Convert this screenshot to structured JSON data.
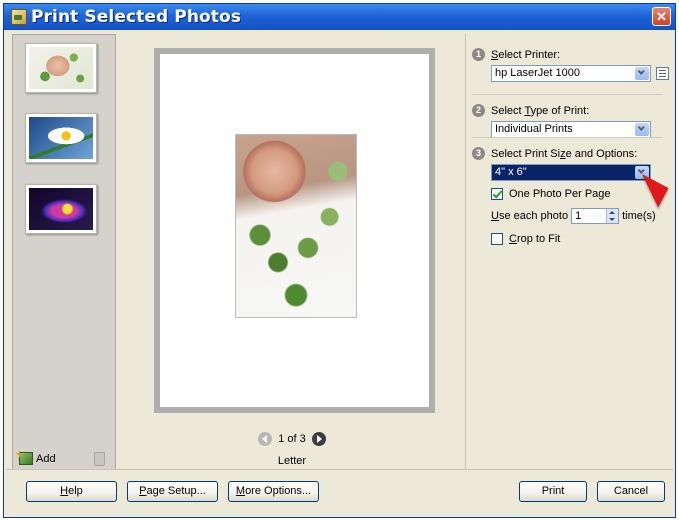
{
  "window": {
    "title": "Print Selected Photos",
    "close_label": "✕"
  },
  "sidebar": {
    "thumbnails": [
      {
        "subject": "portrait with leaves"
      },
      {
        "subject": "daisy"
      },
      {
        "subject": "purple flower"
      }
    ],
    "add_label": "Add",
    "icons": [
      "add-photo-icon",
      "trash-icon"
    ]
  },
  "preview": {
    "page_indicator": "1 of 3",
    "paper_size": "Letter"
  },
  "options": {
    "step1": {
      "number": "1",
      "label_pre": "",
      "label_accel": "S",
      "label_post": "elect Printer:",
      "value": "hp LaserJet 1000"
    },
    "step2": {
      "number": "2",
      "label_pre": "Select ",
      "label_accel": "T",
      "label_post": "ype of Print:",
      "value": "Individual Prints"
    },
    "step3": {
      "number": "3",
      "label_pre": "Select Print Si",
      "label_accel": "z",
      "label_post": "e and Options:",
      "value": "4\" x 6\""
    },
    "one_photo": {
      "label_pre": "One Photo Per Pa",
      "label_accel": "g",
      "label_post": "e",
      "checked": true
    },
    "use_each": {
      "label_accel": "U",
      "label_post": "se each photo",
      "value": "1",
      "suffix": "time(s)"
    },
    "crop": {
      "label_pre": "",
      "label_accel": "C",
      "label_post": "rop to Fit",
      "checked": false
    }
  },
  "buttons": {
    "help": {
      "accel": "H",
      "rest": "elp"
    },
    "page_setup": {
      "accel": "P",
      "rest": "age Setup..."
    },
    "more_options": {
      "accel": "M",
      "rest": "ore Options..."
    },
    "print": "Print",
    "cancel": "Cancel"
  },
  "colors": {
    "titlebar": "#1f63d6",
    "selection": "#0a246a",
    "annotation_arrow": "#e01818"
  }
}
